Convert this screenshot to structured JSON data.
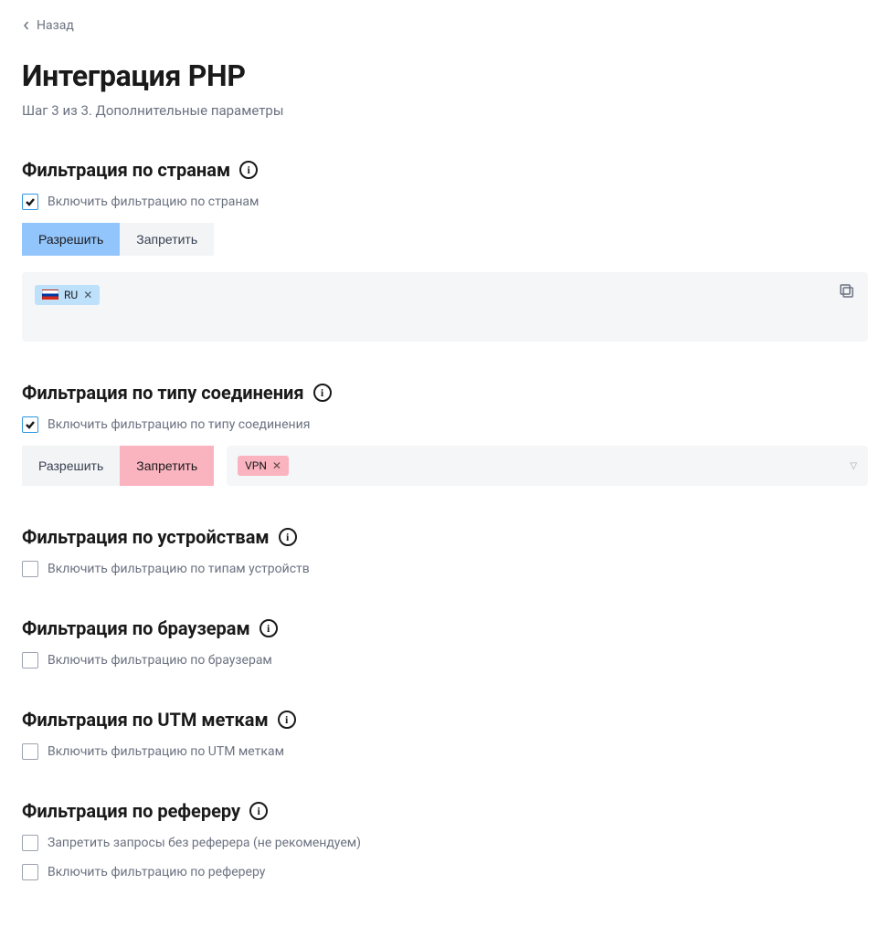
{
  "back": {
    "label": "Назад"
  },
  "title": "Интеграция PHP",
  "step": "Шаг 3 из 3. Дополнительные параметры",
  "toggles": {
    "allow": "Разрешить",
    "deny": "Запретить"
  },
  "sections": {
    "countries": {
      "title": "Фильтрация по странам",
      "enable_label": "Включить фильтрацию по странам",
      "enabled": true,
      "mode": "allow",
      "tags": [
        {
          "code": "RU"
        }
      ]
    },
    "connection": {
      "title": "Фильтрация по типу соединения",
      "enable_label": "Включить фильтрацию по типу соединения",
      "enabled": true,
      "mode": "deny",
      "tags": [
        {
          "code": "VPN"
        }
      ]
    },
    "devices": {
      "title": "Фильтрация по устройствам",
      "enable_label": "Включить фильтрацию по типам устройств",
      "enabled": false
    },
    "browsers": {
      "title": "Фильтрация по браузерам",
      "enable_label": "Включить фильтрацию по браузерам",
      "enabled": false
    },
    "utm": {
      "title": "Фильтрация по UTM меткам",
      "enable_label": "Включить фильтрацию по UTM меткам",
      "enabled": false
    },
    "referer": {
      "title": "Фильтрация по рефереру",
      "noref_label": "Запретить запросы без реферера (не рекомендуем)",
      "enable_label": "Включить фильтрацию по рефереру",
      "noref_enabled": false,
      "enabled": false
    }
  }
}
